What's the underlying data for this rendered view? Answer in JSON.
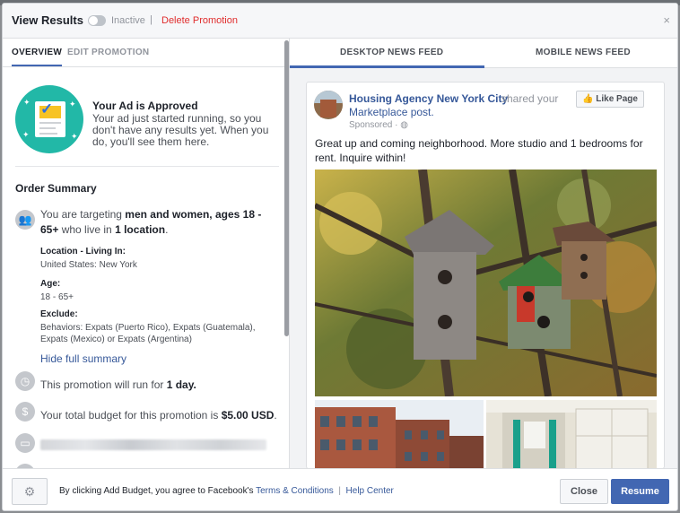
{
  "header": {
    "title": "View Results",
    "status": "Inactive",
    "separator": "|",
    "delete_label": "Delete Promotion",
    "close_icon": "×"
  },
  "left_tabs": [
    "OVERVIEW",
    "EDIT PROMOTION"
  ],
  "approved": {
    "title": "Your Ad is Approved",
    "text": "Your ad just started running, so you don't have any results yet. When you do, you'll see them here."
  },
  "order_summary": {
    "title": "Order Summary",
    "target_pre": "You are targeting ",
    "target_bold": "men and women, ages 18 - 65+",
    "target_mid": " who live in ",
    "target_loc": "1 location",
    "target_end": ".",
    "location_label": "Location - Living In:",
    "location_value": "United States: New York",
    "age_label": "Age:",
    "age_value": "18 - 65+",
    "exclude_label": "Exclude:",
    "exclude_value": "Behaviors: Expats (Puerto Rico), Expats (Guatemala), Expats (Mexico) or Expats (Argentina)",
    "hide_summary": "Hide full summary",
    "duration_pre": "This promotion will run for ",
    "duration_bold": "1 day.",
    "budget_pre": "Your total budget for this promotion is ",
    "budget_bold": "$5.00 USD",
    "budget_end": "."
  },
  "preview_tabs": [
    "DESKTOP NEWS FEED",
    "MOBILE NEWS FEED"
  ],
  "post": {
    "page_name": "Housing Agency New York City",
    "shared": "shared your",
    "marketplace": "Marketplace post.",
    "sponsored": "Sponsored · ",
    "globe_icon": "globe-icon",
    "like_label": "Like Page",
    "text": "Great up and coming neighborhood. More studio and 1 bedrooms for rent. Inquire within!"
  },
  "footer": {
    "agree_pre": "By clicking Add Budget, you agree to Facebook's ",
    "terms": "Terms & Conditions",
    "pipe": "|",
    "help": "Help Center",
    "close_label": "Close",
    "resume_label": "Resume"
  },
  "colors": {
    "accent": "#4267b2",
    "link": "#365899",
    "delete": "#e02d2d",
    "approved_circle": "#22b8a7"
  }
}
